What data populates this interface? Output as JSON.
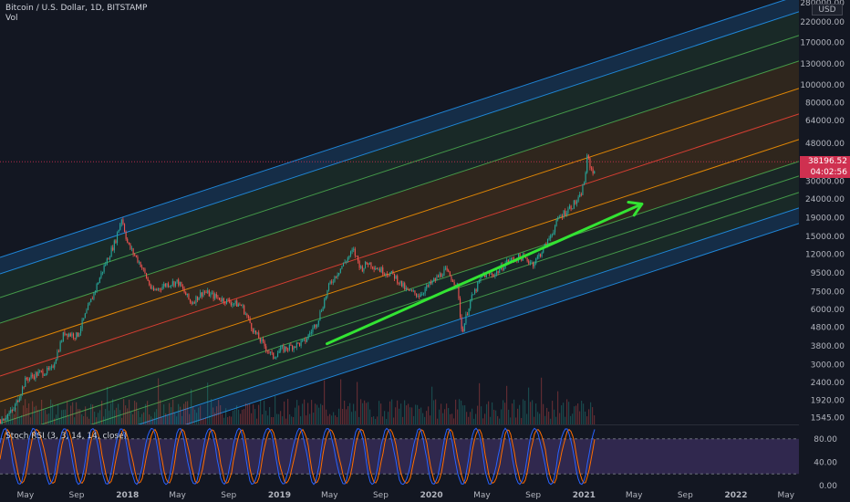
{
  "header": {
    "symbol": "Bitcoin / U.S. Dollar, 1D, BITSTAMP",
    "volume_label": "Vol",
    "currency": "USD"
  },
  "price_tag": {
    "price": "38196.52",
    "countdown": "04:02:56",
    "price_value": 38196.52
  },
  "chart_data": [
    {
      "type": "line",
      "name": "price-pane",
      "x_axis": {
        "tick_labels": [
          "May",
          "Sep",
          "2018",
          "May",
          "Sep",
          "2019",
          "May",
          "Sep",
          "2020",
          "May",
          "Sep",
          "2021",
          "May",
          "Sep",
          "2022",
          "May"
        ],
        "tick_dates": [
          "2017-05-01",
          "2017-09-01",
          "2018-01-01",
          "2018-05-01",
          "2018-09-01",
          "2019-01-01",
          "2019-05-01",
          "2019-09-01",
          "2020-01-01",
          "2020-05-01",
          "2020-09-01",
          "2021-01-01",
          "2021-05-01",
          "2021-09-01",
          "2022-01-01",
          "2022-05-01"
        ],
        "range": [
          "2017-03-01",
          "2022-06-01"
        ]
      },
      "y_axis": {
        "scale": "log",
        "tick_labels": [
          "1545.00",
          "1920.00",
          "2400.00",
          "3000.00",
          "3800.00",
          "4800.00",
          "6000.00",
          "7500.00",
          "9500.00",
          "12000.00",
          "15000.00",
          "19000.00",
          "24000.00",
          "30000.00",
          "38000.00",
          "48000.00",
          "64000.00",
          "80000.00",
          "100000.00",
          "130000.00",
          "170000.00",
          "220000.00",
          "280000.00"
        ],
        "tick_values": [
          1545,
          1920,
          2400,
          3000,
          3800,
          4800,
          6000,
          7500,
          9500,
          12000,
          15000,
          19000,
          24000,
          30000,
          38000,
          48000,
          64000,
          80000,
          100000,
          130000,
          170000,
          220000,
          280000
        ],
        "range": [
          1420,
          290000
        ]
      },
      "series": [
        {
          "type": "candles",
          "x": [
            "2017-03-01",
            "2017-04-01",
            "2017-05-01",
            "2017-06-01",
            "2017-07-01",
            "2017-08-01",
            "2017-09-01",
            "2017-10-01",
            "2017-11-01",
            "2017-12-01",
            "2017-12-17",
            "2018-01-01",
            "2018-02-01",
            "2018-03-01",
            "2018-04-01",
            "2018-05-01",
            "2018-06-01",
            "2018-07-01",
            "2018-08-01",
            "2018-09-01",
            "2018-10-01",
            "2018-11-01",
            "2018-12-15",
            "2019-01-01",
            "2019-02-01",
            "2019-03-01",
            "2019-04-01",
            "2019-05-01",
            "2019-06-01",
            "2019-06-26",
            "2019-07-15",
            "2019-08-01",
            "2019-09-01",
            "2019-10-01",
            "2019-11-01",
            "2019-12-01",
            "2020-01-01",
            "2020-02-01",
            "2020-03-01",
            "2020-03-13",
            "2020-04-01",
            "2020-05-01",
            "2020-06-01",
            "2020-07-01",
            "2020-08-01",
            "2020-09-01",
            "2020-10-01",
            "2020-11-01",
            "2020-12-01",
            "2020-12-20",
            "2021-01-01",
            "2021-01-08",
            "2021-01-15",
            "2021-01-22",
            "2021-01-28"
          ],
          "close": [
            1500,
            1700,
            2500,
            2700,
            2800,
            4500,
            4300,
            6400,
            9800,
            14000,
            19000,
            13500,
            10500,
            7500,
            8200,
            8500,
            6500,
            7500,
            7000,
            6600,
            6300,
            4500,
            3300,
            3600,
            3800,
            4000,
            5200,
            8300,
            10500,
            12600,
            10000,
            10800,
            9800,
            9200,
            7600,
            7200,
            8400,
            9800,
            8200,
            4500,
            6600,
            9200,
            9400,
            11000,
            11600,
            10700,
            13500,
            19000,
            22000,
            24000,
            30000,
            41000,
            36000,
            33000,
            38196.52
          ]
        },
        {
          "type": "line",
          "name": "arrow",
          "x": [
            "2019-04-25",
            "2021-05-20"
          ],
          "y": [
            3900,
            22500
          ]
        }
      ]
    },
    {
      "type": "line",
      "name": "stoch-rsi",
      "title": "Stoch RSI (3, 3, 14, 14, close)",
      "y_axis": {
        "tick_labels": [
          "80.00",
          "40.00",
          "0.00"
        ],
        "tick_values": [
          80,
          40,
          0
        ],
        "range": [
          0,
          100
        ]
      },
      "band": [
        20,
        80
      ]
    }
  ],
  "colors": {
    "background": "#131722",
    "axis_text": "#b2b5be",
    "up": "#26a69a",
    "down": "#ef5350",
    "arrow": "#33e433",
    "channel_blue": "#2196f3",
    "channel_green": "#4caf50",
    "channel_orange": "#ff9800",
    "channel_red": "#f44336",
    "stoch_k": "#2962ff",
    "stoch_d": "#ff6d00",
    "stoch_band": "#7e57c2",
    "price_tag": "#cf3050"
  }
}
